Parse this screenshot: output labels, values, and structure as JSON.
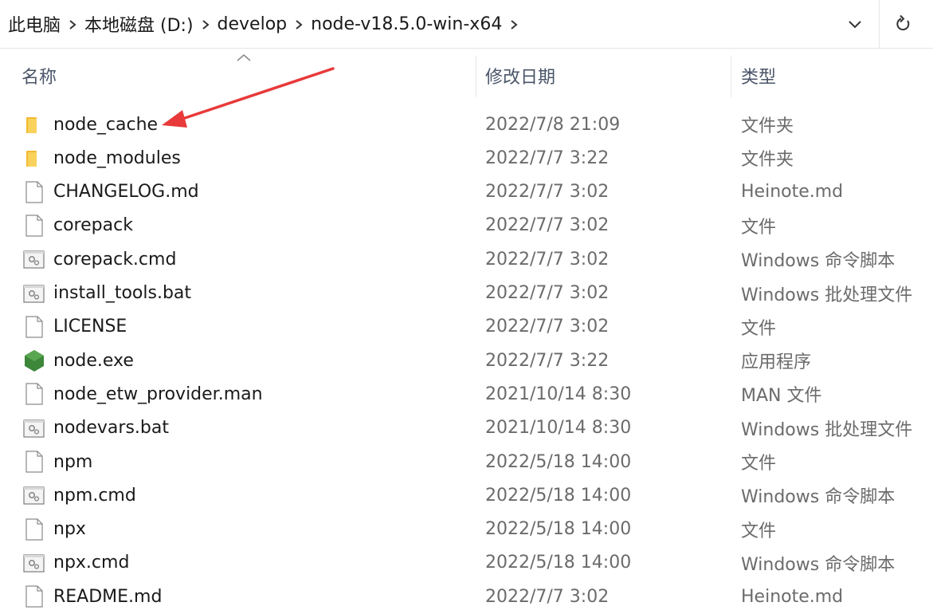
{
  "breadcrumb": {
    "items": [
      "此电脑",
      "本地磁盘 (D:)",
      "develop",
      "node-v18.5.0-win-x64"
    ]
  },
  "columns": {
    "name": "名称",
    "date": "修改日期",
    "type": "类型"
  },
  "files": [
    {
      "name": "node_cache",
      "date": "2022/7/8 21:09",
      "type": "文件夹",
      "icon": "folder-icon"
    },
    {
      "name": "node_modules",
      "date": "2022/7/7 3:22",
      "type": "文件夹",
      "icon": "folder-icon"
    },
    {
      "name": "CHANGELOG.md",
      "date": "2022/7/7 3:02",
      "type": "Heinote.md",
      "icon": "file-icon"
    },
    {
      "name": "corepack",
      "date": "2022/7/7 3:02",
      "type": "文件",
      "icon": "file-icon"
    },
    {
      "name": "corepack.cmd",
      "date": "2022/7/7 3:02",
      "type": "Windows 命令脚本",
      "icon": "batch-file-icon"
    },
    {
      "name": "install_tools.bat",
      "date": "2022/7/7 3:02",
      "type": "Windows 批处理文件",
      "icon": "batch-file-icon"
    },
    {
      "name": "LICENSE",
      "date": "2022/7/7 3:02",
      "type": "文件",
      "icon": "file-icon"
    },
    {
      "name": "node.exe",
      "date": "2022/7/7 3:22",
      "type": "应用程序",
      "icon": "nodejs-icon"
    },
    {
      "name": "node_etw_provider.man",
      "date": "2021/10/14 8:30",
      "type": "MAN 文件",
      "icon": "file-icon"
    },
    {
      "name": "nodevars.bat",
      "date": "2021/10/14 8:30",
      "type": "Windows 批处理文件",
      "icon": "batch-file-icon"
    },
    {
      "name": "npm",
      "date": "2022/5/18 14:00",
      "type": "文件",
      "icon": "file-icon"
    },
    {
      "name": "npm.cmd",
      "date": "2022/5/18 14:00",
      "type": "Windows 命令脚本",
      "icon": "batch-file-icon"
    },
    {
      "name": "npx",
      "date": "2022/5/18 14:00",
      "type": "文件",
      "icon": "file-icon"
    },
    {
      "name": "npx.cmd",
      "date": "2022/5/18 14:00",
      "type": "Windows 命令脚本",
      "icon": "batch-file-icon"
    },
    {
      "name": "README.md",
      "date": "2022/7/7 3:02",
      "type": "Heinote.md",
      "icon": "file-icon"
    }
  ],
  "colors": {
    "folder": "#f5c242",
    "annotation_arrow": "#e83a3a",
    "node_green": "#3c873a"
  }
}
